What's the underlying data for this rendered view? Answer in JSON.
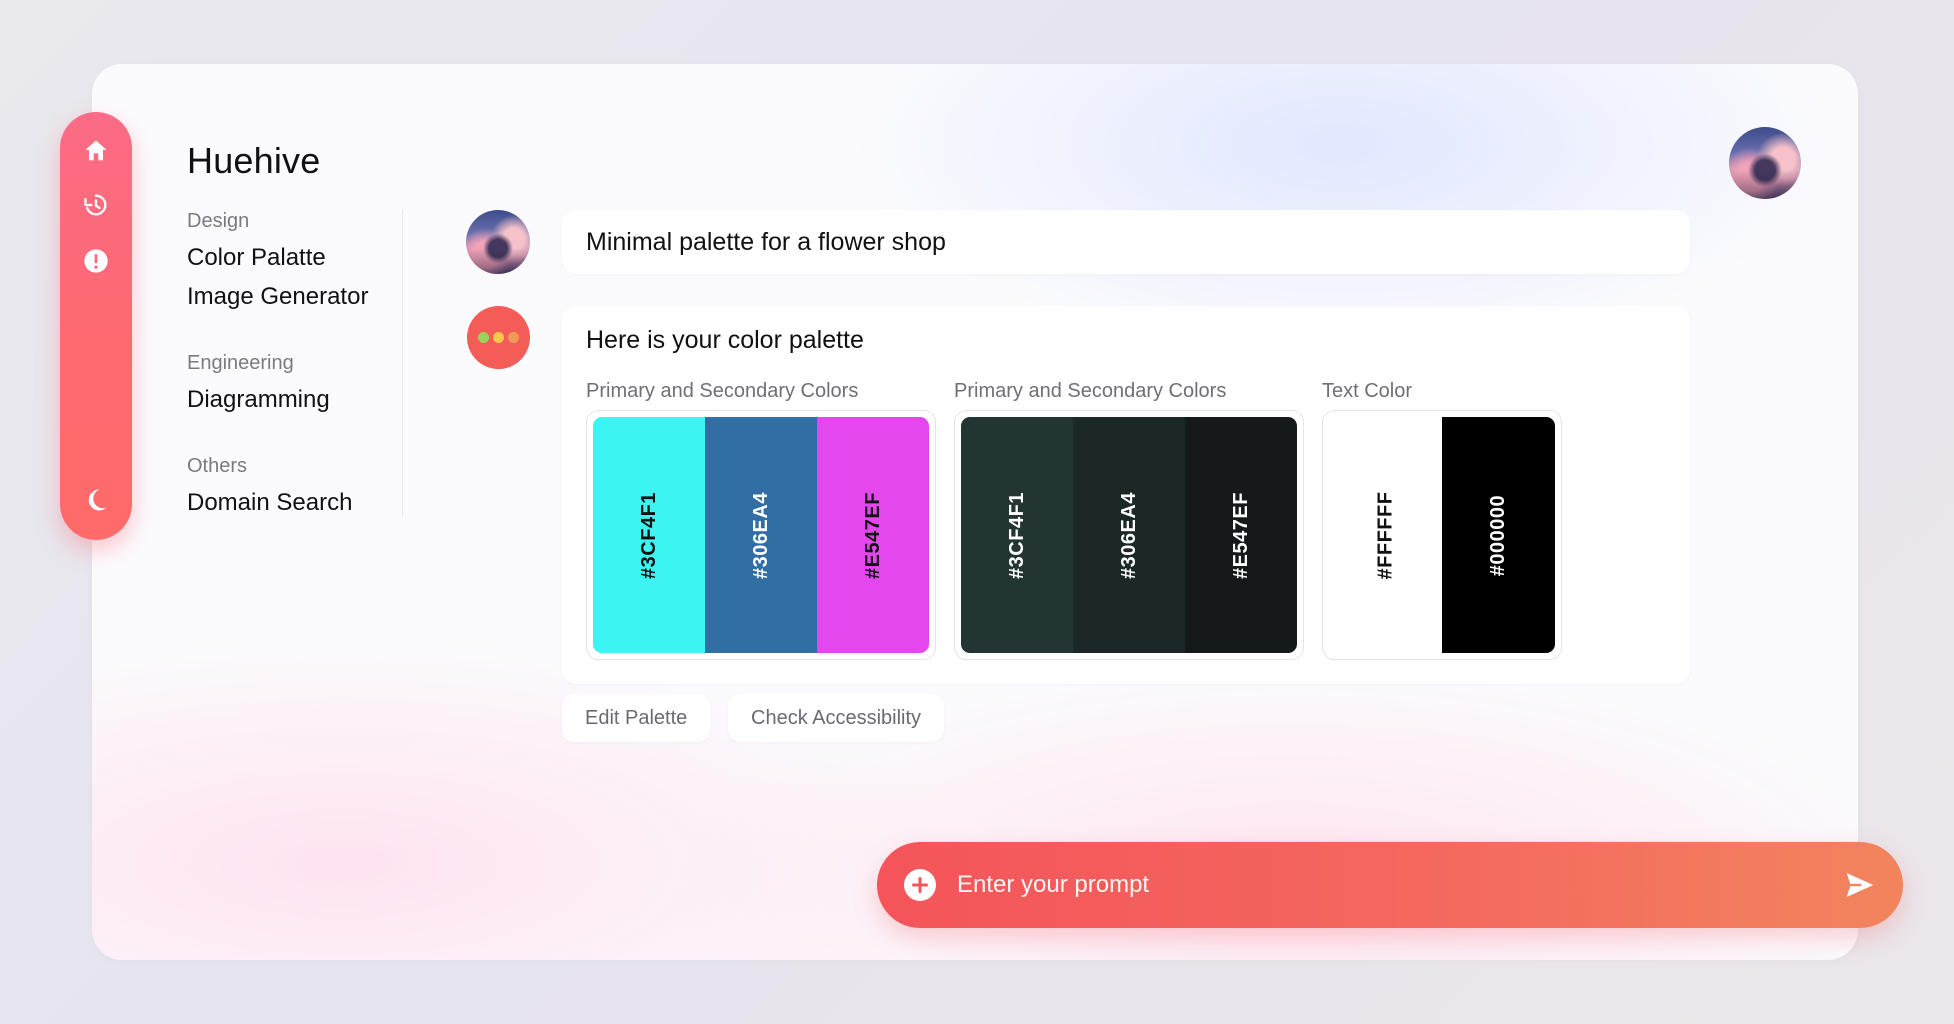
{
  "app": {
    "brand": "Huehive"
  },
  "rail": {
    "icons": [
      "home-icon",
      "history-icon",
      "alert-icon",
      "moon-icon"
    ],
    "color_top": "#fb6b86",
    "color_bottom": "#ff6a6a"
  },
  "sidebar": {
    "groups": [
      {
        "title": "Design",
        "items": [
          "Color Palatte",
          "Image Generator"
        ]
      },
      {
        "title": "Engineering",
        "items": [
          "Diagramming"
        ]
      },
      {
        "title": "Others",
        "items": [
          "Domain Search"
        ]
      }
    ]
  },
  "chat": {
    "user_message": "Minimal palette for a flower shop",
    "bot_intro": "Here is your color palette",
    "palettes": [
      {
        "title": "Primary and Secondary Colors",
        "swatches": [
          {
            "hex": "#3CF4F1",
            "color": "#3CF4F1",
            "text_color": "#111111"
          },
          {
            "hex": "#306EA4",
            "color": "#306EA4",
            "text_color": "#FFFFFF"
          },
          {
            "hex": "#E547EF",
            "color": "#E547EF",
            "text_color": "#111111"
          }
        ]
      },
      {
        "title": "Primary and Secondary Colors",
        "swatches": [
          {
            "hex": "#3CF4F1",
            "color": "#223533",
            "text_color": "#FFFFFF"
          },
          {
            "hex": "#306EA4",
            "color": "#1C2828",
            "text_color": "#FFFFFF"
          },
          {
            "hex": "#E547EF",
            "color": "#151919",
            "text_color": "#FFFFFF"
          }
        ]
      },
      {
        "title": "Text Color",
        "swatches": [
          {
            "hex": "#FFFFFF",
            "color": "#FFFFFF",
            "text_color": "#111111"
          },
          {
            "hex": "#000000",
            "color": "#000000",
            "text_color": "#FFFFFF"
          }
        ]
      }
    ],
    "actions": [
      "Edit Palette",
      "Check Accessibility"
    ],
    "bot_avatar": {
      "bg": "#f35c57",
      "dots": [
        "#9bd35a",
        "#f6c94c",
        "#f29a55"
      ]
    }
  },
  "prompt": {
    "placeholder": "Enter your prompt"
  }
}
